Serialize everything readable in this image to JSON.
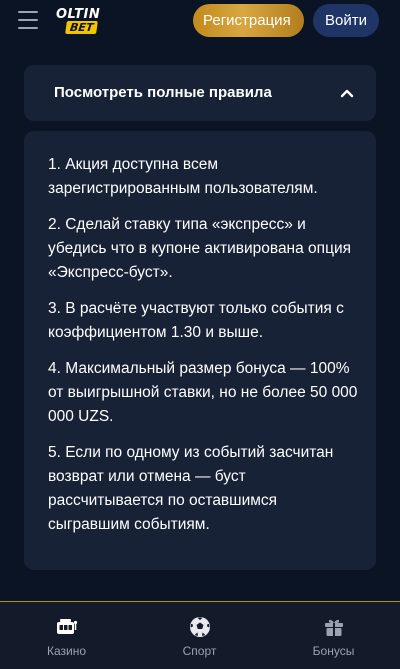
{
  "header": {
    "menu_icon": "hamburger-menu-icon",
    "logo_line1": "OLTIN",
    "logo_line2": "BET",
    "register_label": "Регистрация",
    "login_label": "Войти"
  },
  "rules_toggle": {
    "title": "Посмотреть полные правила",
    "chevron_icon": "chevron-up-icon"
  },
  "rules": [
    "1. Акция доступна всем зарегистрированным пользователям.",
    "2. Сделай ставку типа «экспресс» и убедись что в купоне активирована опция «Экспресс-буст».",
    "3. В расчёте участвуют только события с коэффициентом 1.30 и выше.",
    "4. Максимальный размер бонуса — 100% от выигрышной ставки, но не более 50 000 000 UZS.",
    "5. Если по одному из событий засчитан возврат или отмена — буст рассчитывается по оставшимся сыгравшим событиям."
  ],
  "bottom_nav": [
    {
      "label": "Казино",
      "icon": "casino-icon"
    },
    {
      "label": "Спорт",
      "icon": "soccer-ball-icon"
    },
    {
      "label": "Бонусы",
      "icon": "gift-icon"
    }
  ],
  "colors": {
    "background": "#0b1424",
    "card": "#172236",
    "register_gold": "#d9a640",
    "login_blue": "#1f3566",
    "nav_border": "#b58a2a"
  }
}
